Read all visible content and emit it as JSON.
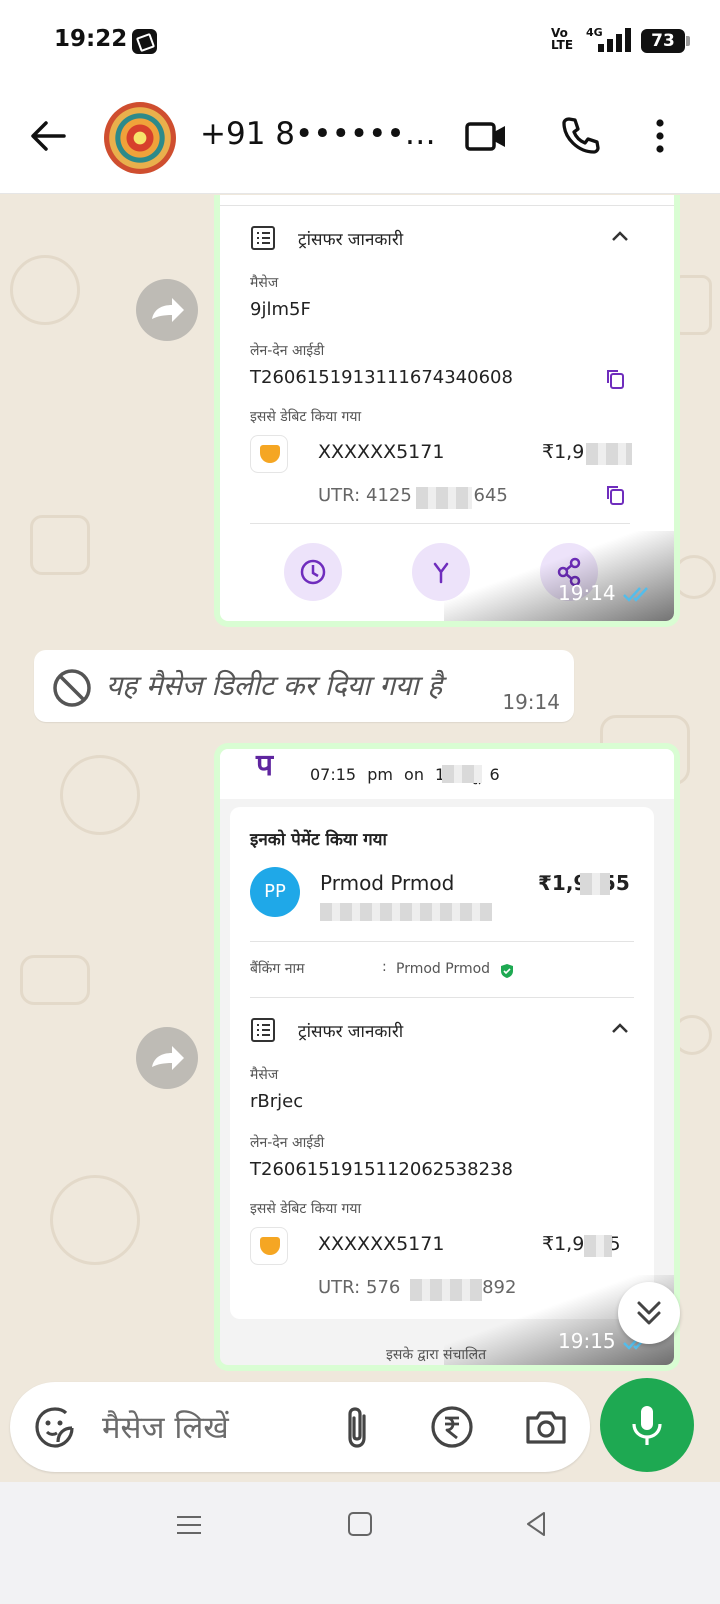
{
  "status_bar": {
    "time": "19:22",
    "network_volte": "Vo\nLTE",
    "network_type": "4G",
    "battery": "73"
  },
  "header": {
    "contact_name": "+91 8••••••72..."
  },
  "messages": [
    {
      "type": "payment-screenshot",
      "transfer_info_label": "ट्रांसफर जानकारी",
      "message_label": "मैसेज",
      "message_value": "9jlm5F",
      "txn_id_label": "लेन-देन आईडी",
      "txn_id": "T2606151913111674340608",
      "debited_from_label": "इससे डेबिट किया गया",
      "account": "XXXXXX5171",
      "amount": "₹1,9 88",
      "utr_label": "UTR:",
      "utr": "4125 645",
      "time": "19:14",
      "read": true
    },
    {
      "type": "deleted",
      "text": "यह मैसेज डिलीट कर दिया गया है",
      "time": "19:14"
    },
    {
      "type": "payment-screenshot",
      "datetime": "07:15 pm on 15 जू 6",
      "paid_to_label": "इनको पेमेंट किया गया",
      "payee_initials": "PP",
      "payee_name": "Prmod Prmod",
      "payee_amount": "₹1,9 .55",
      "banking_name_label": "बैंकिंग नाम",
      "banking_name": "Prmod Prmod",
      "transfer_info_label": "ट्रांसफर जानकारी",
      "message_label": "मैसेज",
      "message_value": "rBrjec",
      "txn_id_label": "लेन-देन आईडी",
      "txn_id": "T2606151915112062538238",
      "debited_from_label": "इससे डेबिट किया गया",
      "account": "XXXXXX5171",
      "amount": "₹1,9 .55",
      "utr_label": "UTR:",
      "utr": "576 892",
      "powered_by": "इसके द्वारा संचालित",
      "time": "19:15",
      "read": true
    }
  ],
  "composer": {
    "placeholder": "मैसेज लिखें"
  },
  "colors": {
    "accent_green": "#1ea952",
    "bubble_out": "#d9fdd3",
    "read_ticks": "#53bdeb",
    "phonepe_purple": "#5f259f"
  },
  "icons": [
    "back-arrow-icon",
    "video-call-icon",
    "phone-icon",
    "more-vert-icon",
    "forward-icon",
    "blocked-icon",
    "sticker-icon",
    "attach-icon",
    "rupee-icon",
    "camera-icon",
    "mic-icon",
    "double-chevron-down-icon"
  ]
}
